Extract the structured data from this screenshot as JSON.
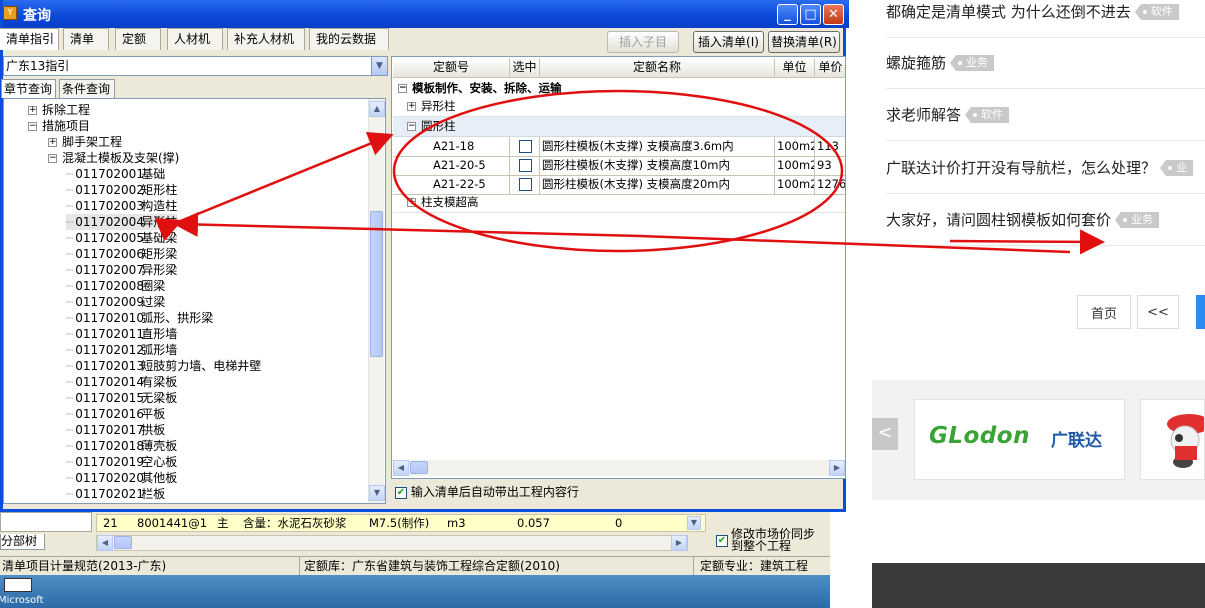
{
  "dialog": {
    "title": "查询",
    "icon_text": "Y",
    "tabs": [
      "清单指引",
      "清单",
      "定额",
      "人材机",
      "补充人材机",
      "我的云数据"
    ],
    "buttons": {
      "insert_child": "插入子目",
      "insert_list": "插入清单(I)",
      "replace_list": "替换清单(R)"
    },
    "guide_select": "广东13指引",
    "subtabs": [
      "章节查询",
      "条件查询"
    ],
    "tree": {
      "parents": [
        {
          "label": "拆除工程",
          "toggle": "+"
        },
        {
          "label": "措施项目",
          "toggle": "−"
        },
        {
          "label": "脚手架工程",
          "toggle": "+"
        },
        {
          "label": "混凝土模板及支架(撑)",
          "toggle": "−"
        }
      ],
      "items": [
        {
          "code": "011702001",
          "name": "基础"
        },
        {
          "code": "011702002",
          "name": "矩形柱"
        },
        {
          "code": "011702003",
          "name": "构造柱"
        },
        {
          "code": "011702004",
          "name": "异形柱"
        },
        {
          "code": "011702005",
          "name": "基础梁"
        },
        {
          "code": "011702006",
          "name": "矩形梁"
        },
        {
          "code": "011702007",
          "name": "异形梁"
        },
        {
          "code": "011702008",
          "name": "圈梁"
        },
        {
          "code": "011702009",
          "name": "过梁"
        },
        {
          "code": "011702010",
          "name": "弧形、拱形梁"
        },
        {
          "code": "011702011",
          "name": "直形墙"
        },
        {
          "code": "011702012",
          "name": "弧形墙"
        },
        {
          "code": "011702013",
          "name": "短肢剪力墙、电梯井壁"
        },
        {
          "code": "011702014",
          "name": "有梁板"
        },
        {
          "code": "011702015",
          "name": "无梁板"
        },
        {
          "code": "011702016",
          "name": "平板"
        },
        {
          "code": "011702017",
          "name": "拱板"
        },
        {
          "code": "011702018",
          "name": "薄壳板"
        },
        {
          "code": "011702019",
          "name": "空心板"
        },
        {
          "code": "011702020",
          "name": "其他板"
        },
        {
          "code": "011702021",
          "name": "栏板"
        }
      ]
    },
    "grid": {
      "headers": [
        "定额号",
        "选中",
        "定额名称",
        "单位",
        "单价"
      ],
      "group_title": "模板制作、安装、拆除、运输",
      "groups": [
        {
          "label": "异形柱",
          "toggle": "+"
        },
        {
          "label": "圆形柱",
          "toggle": "−"
        },
        {
          "label": "柱支模超高",
          "toggle": "+"
        }
      ],
      "rows": [
        {
          "code": "A21-18",
          "checked": false,
          "name": "圆形柱模板(木支撑) 支模高度3.6m内",
          "unit": "100m2",
          "price": "113"
        },
        {
          "code": "A21-20-5",
          "checked": false,
          "name": "圆形柱模板(木支撑) 支模高度10m内",
          "unit": "100m2",
          "price": "93"
        },
        {
          "code": "A21-22-5",
          "checked": false,
          "name": "圆形柱模板(木支撑) 支模高度20m内",
          "unit": "100m2",
          "price": "1276"
        }
      ]
    },
    "auto_check_label": "输入清单后自动带出工程内容行",
    "auto_check": true
  },
  "bottom": {
    "row": {
      "no": "21",
      "code": "8001441@1",
      "type": "主",
      "desc": "含量：水泥石灰砂浆",
      "spec": "M7.5(制作)",
      "unit": "m3",
      "qty": "0.057",
      "val": "0"
    },
    "tab_label": "分部树",
    "sync_label": "修改市场价同步到整个工程",
    "sync_checked": true
  },
  "status": {
    "norm": "清单项目计量规范(2013-广东)",
    "lib": "定额库：广东省建筑与装饰工程综合定额(2010)",
    "major": "定额专业：建筑工程"
  },
  "taskbar": {
    "text": "Microsoft"
  },
  "web": {
    "questions": [
      {
        "text": "都确定是清单模式 为什么还倒不进去",
        "tag": "软件"
      },
      {
        "text": "螺旋箍筋",
        "tag": "业务"
      },
      {
        "text": "求老师解答",
        "tag": "软件"
      },
      {
        "text": "广联达计价打开没有导航栏，怎么处理？",
        "tag": "业"
      },
      {
        "text": "大家好，请问圆柱钢模板如何套价",
        "tag": "业务"
      }
    ],
    "pager": {
      "first": "首页",
      "prev": "<<"
    },
    "ad_logo_en": "GLodon",
    "ad_logo_cn": "广联达",
    "ad_prev": "<"
  },
  "colors": {
    "annotation": "#e01010",
    "titlebar": "#0a47d6",
    "brand_green": "#3aa336",
    "brand_blue": "#1e5aa8",
    "pager_blue": "#2a8cf0"
  }
}
